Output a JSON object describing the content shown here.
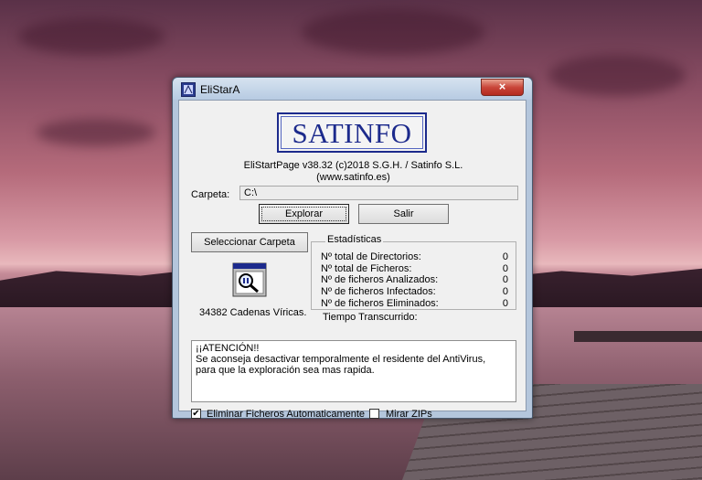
{
  "window": {
    "title": "EliStarA",
    "close_glyph": "×"
  },
  "logo": {
    "text": "SATINFO"
  },
  "header": {
    "version": "EliStartPage v38.32 (c)2018  S.G.H. / Satinfo S.L.",
    "website": "(www.satinfo.es)"
  },
  "carpeta": {
    "label": "Carpeta:",
    "value": "C:\\"
  },
  "buttons": {
    "explorar": "Explorar",
    "salir": "Salir",
    "seleccionar": "Seleccionar Carpeta"
  },
  "scan_icon": "magnifier-scan-icon",
  "cadenas": "34382 Cadenas Víricas.",
  "stats": {
    "title": "Estadísticas",
    "rows": [
      {
        "label": "Nº total de Directorios:",
        "value": "0"
      },
      {
        "label": "Nº total de Ficheros:",
        "value": "0"
      },
      {
        "label": "Nº de ficheros Analizados:",
        "value": "0"
      },
      {
        "label": "Nº de ficheros Infectados:",
        "value": "0"
      },
      {
        "label": "Nº de ficheros Eliminados:",
        "value": "0"
      }
    ],
    "tiempo": "Tiempo Transcurrido:"
  },
  "message": {
    "line1": "¡¡ATENCIÓN!!",
    "line2": "Se aconseja desactivar temporalmente el residente del AntiVirus,",
    "line3": "para que la exploración sea mas rapida."
  },
  "options": {
    "eliminar": {
      "label": "Eliminar Ficheros Automaticamente",
      "checked": true,
      "mark": "✔"
    },
    "zips": {
      "label": "Mirar ZIPs",
      "checked": false,
      "mark": ""
    }
  }
}
